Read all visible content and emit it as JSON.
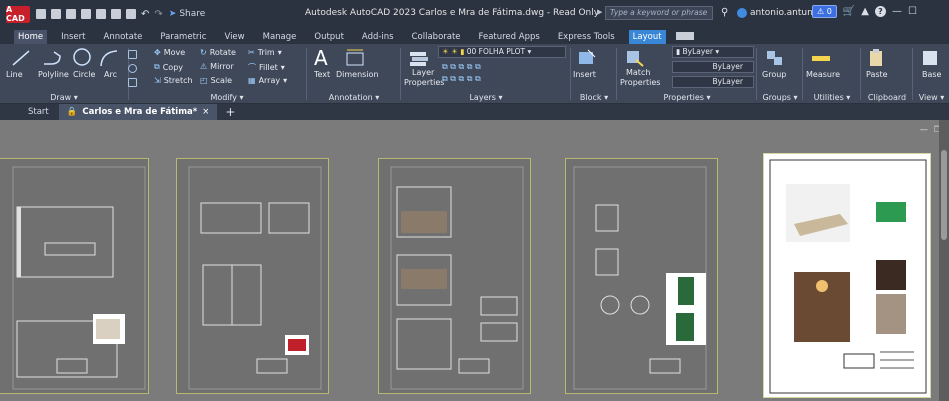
{
  "titlebar": {
    "logo": "A CAD",
    "share": "Share",
    "title": "Autodesk AutoCAD 2023   Carlos e Mra de Fátima.dwg - Read Only",
    "search_placeholder": "Type a keyword or phrase",
    "user": "antonio.antun...",
    "notif_count": "0"
  },
  "tabs": [
    "Home",
    "Insert",
    "Annotate",
    "Parametric",
    "View",
    "Manage",
    "Output",
    "Add-ins",
    "Collaborate",
    "Featured Apps",
    "Express Tools",
    "Layout"
  ],
  "ribbon": {
    "draw": {
      "title": "Draw",
      "line": "Line",
      "polyline": "Polyline",
      "circle": "Circle",
      "arc": "Arc"
    },
    "modify": {
      "title": "Modify",
      "move": "Move",
      "rotate": "Rotate",
      "trim": "Trim",
      "copy": "Copy",
      "mirror": "Mirror",
      "fillet": "Fillet",
      "stretch": "Stretch",
      "scale": "Scale",
      "array": "Array"
    },
    "annotation": {
      "title": "Annotation",
      "text": "Text",
      "dimension": "Dimension"
    },
    "layers": {
      "title": "Layers",
      "layer_properties_1": "Layer",
      "layer_properties_2": "Properties",
      "current_layer": "00 FOLHA PLOT"
    },
    "block": {
      "title": "Block",
      "insert": "Insert"
    },
    "properties": {
      "title": "Properties",
      "match_1": "Match",
      "match_2": "Properties",
      "color": "ByLayer",
      "linetype": "ByLayer",
      "lineweight": "ByLayer"
    },
    "groups": {
      "title": "Groups",
      "group": "Group"
    },
    "utilities": {
      "title": "Utilities",
      "measure": "Measure"
    },
    "clipboard": {
      "title": "Clipboard",
      "paste": "Paste"
    },
    "view": {
      "title": "View",
      "base": "Base"
    }
  },
  "doctabs": {
    "start": "Start",
    "active": "Carlos e Mra de Fátima*"
  },
  "colors": {
    "titlebar": "#2b3240",
    "ribbon": "#3f4859",
    "layout_tab": "#3a86d6",
    "canvas": "#7b7b7b",
    "sheet_border": "#b8b870"
  }
}
